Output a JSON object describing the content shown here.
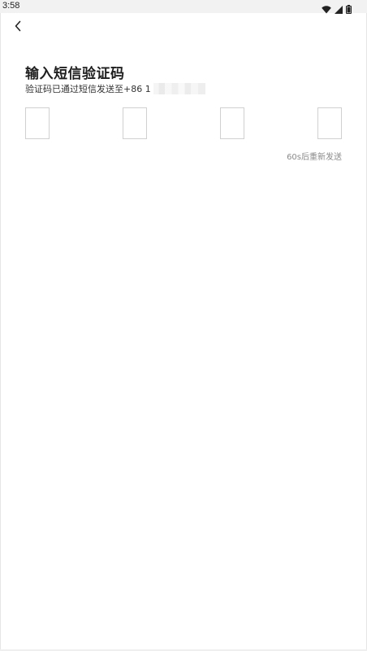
{
  "status_bar": {
    "time": "3:58",
    "icons": [
      "wifi-icon",
      "cell-signal-icon",
      "battery-icon"
    ]
  },
  "header": {
    "back_icon": "chevron-left-icon"
  },
  "main": {
    "title": "输入短信验证码",
    "subtitle_prefix": "验证码已通过短信发送至+86 1",
    "code_boxes": [
      "",
      "",
      "",
      ""
    ],
    "resend_label": "60s后重新发送"
  },
  "colors": {
    "background": "#ffffff",
    "title": "#1f1f1f",
    "subtitle": "#333333",
    "box_border": "#d0d0d0",
    "resend": "#8a8a8a",
    "status_bar": "#f2f2f2"
  }
}
